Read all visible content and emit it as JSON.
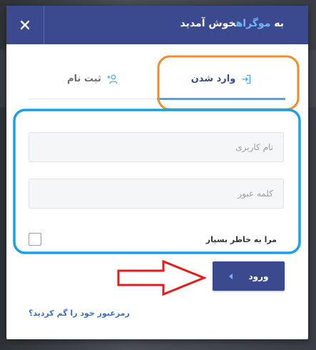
{
  "header": {
    "title_prefix": "به ",
    "brand": "موگراه",
    "title_suffix": "خوش آمدید",
    "bg_color": "#3b4a8e",
    "brand_color": "#6fb6ff"
  },
  "close_button": {
    "label": "×",
    "icon": "close-icon"
  },
  "tabs": [
    {
      "label": "وارد شدن",
      "icon": "login-icon",
      "active": true
    },
    {
      "label": "ثبت نام",
      "icon": "user-plus-icon",
      "active": false
    }
  ],
  "form": {
    "username": {
      "placeholder": "نام کاربری",
      "value": ""
    },
    "password": {
      "placeholder": "کلمه عبور",
      "value": ""
    },
    "remember_label": "مرا به خاطر بسپار",
    "remember_checked": false,
    "submit_label": "ورود",
    "submit_icon": "caret-left-icon"
  },
  "forgot_link": "رمزعبور خود را گم کردید؟",
  "annotations": {
    "tab_highlight_color": "#f28c28",
    "form_highlight_color": "#1aa0e6",
    "arrow_color": "#e31b1b"
  }
}
